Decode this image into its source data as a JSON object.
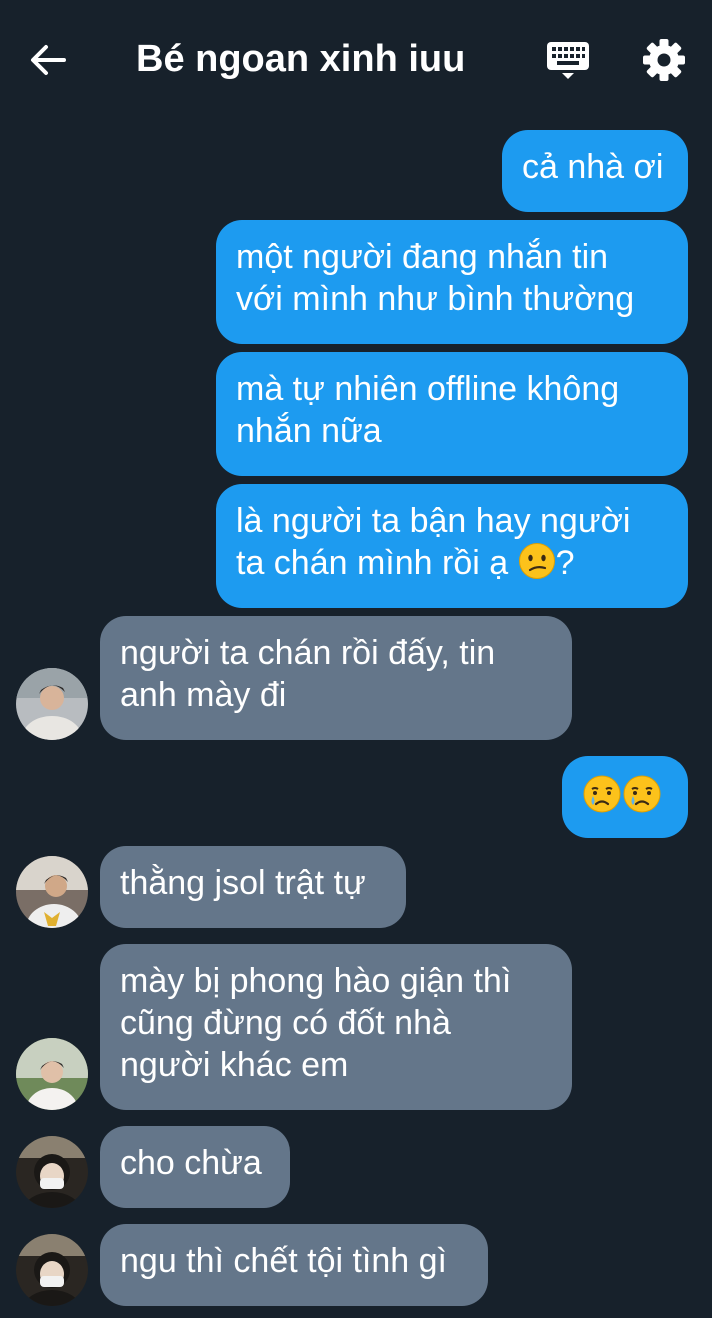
{
  "header": {
    "title": "Bé ngoan xinh iuu",
    "back_icon": "arrow-left-icon",
    "keyboard_icon": "keyboard-icon",
    "settings_icon": "gear-icon"
  },
  "colors": {
    "background": "#17212b",
    "outgoing_bubble": "#1d9bf0",
    "incoming_bubble": "#64768a",
    "text": "#ffffff"
  },
  "messages": [
    {
      "direction": "out",
      "lines": [
        "cả nhà ơi"
      ]
    },
    {
      "direction": "out",
      "lines": [
        "một người đang nhắn tin",
        "với mình như bình thường"
      ]
    },
    {
      "direction": "out",
      "lines": [
        "mà tự nhiên offline không",
        "nhắn nữa"
      ]
    },
    {
      "direction": "out",
      "lines": [
        "là người ta bận hay người",
        "ta chán mình rồi ạ"
      ],
      "trailing_emoji": "confused-face-emoji",
      "trailing_text": "?"
    },
    {
      "direction": "in",
      "lines": [
        "người ta chán rồi đấy, tin",
        "anh mày đi"
      ]
    },
    {
      "direction": "out",
      "lines": [],
      "emoji": [
        "crying-face-emoji",
        "crying-face-emoji"
      ]
    },
    {
      "direction": "in",
      "lines": [
        "thằng jsol trật tự"
      ]
    },
    {
      "direction": "in",
      "lines": [
        "mày bị phong hào giận thì",
        "cũng đừng có đốt nhà",
        "người khác em"
      ]
    },
    {
      "direction": "in",
      "lines": [
        "cho chừa"
      ]
    },
    {
      "direction": "in",
      "lines": [
        "ngu thì chết tội tình gì"
      ]
    }
  ]
}
